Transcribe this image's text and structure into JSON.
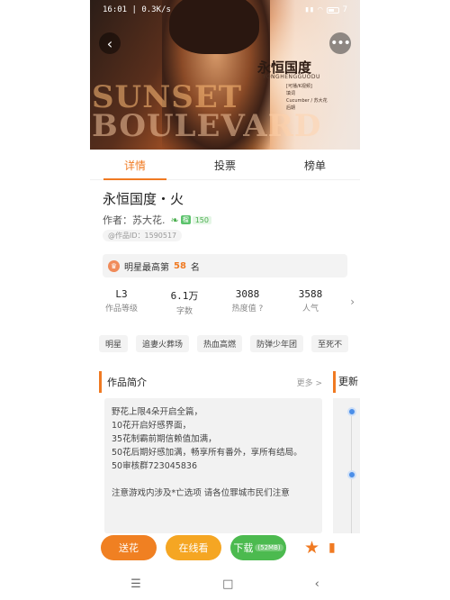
{
  "status_bar": {
    "time": "16:01 | 0.3K/s",
    "battery": "7"
  },
  "banner": {
    "title": "永恒国度",
    "subtitle": "YONGHENGGUODU",
    "credits": "[可播/K视频]\n填词\nCucumber / 苏大花\n后期",
    "art_text_1": "SUNSET",
    "art_text_2": "BOULEVARD"
  },
  "tabs": [
    {
      "label": "详情",
      "active": true
    },
    {
      "label": "投票",
      "active": false
    },
    {
      "label": "榜单",
      "active": false
    }
  ],
  "work": {
    "title": "永恒国度・火",
    "author_label": "作者：",
    "author_name": "苏大花.",
    "level_badge": "榴",
    "level_value": "150",
    "work_id": "@作品ID：1590517"
  },
  "rank": {
    "prefix": "明星最高第",
    "number": "58",
    "suffix": "名"
  },
  "stats": [
    {
      "value": "L3",
      "label": "作品等级"
    },
    {
      "value": "6.1万",
      "label": "字数"
    },
    {
      "value": "3088",
      "label": "热度值 ?"
    },
    {
      "value": "3588",
      "label": "人气"
    }
  ],
  "tags": [
    "明星",
    "追妻火葬场",
    "热血高燃",
    "防弹少年团",
    "至死不"
  ],
  "intro_section": {
    "title": "作品简介",
    "more": "更多 >",
    "text": "野花上限4朵开启全篇，\n10花开启好感界面，\n35花制霸前期信赖值加满，\n50花后期好感加满，畅享所有番外，享所有结局。\n50审核群723045836\n\n注意游戏内涉及*亡选项  请各位罪城市民们注意"
  },
  "side_section": {
    "title": "更新"
  },
  "actions": {
    "gift": "送花",
    "read": "在线看",
    "download": "下载",
    "download_size": "(52MB)"
  },
  "colors": {
    "accent": "#f07a22",
    "green": "#4cba4f",
    "yellow": "#f5a623"
  }
}
